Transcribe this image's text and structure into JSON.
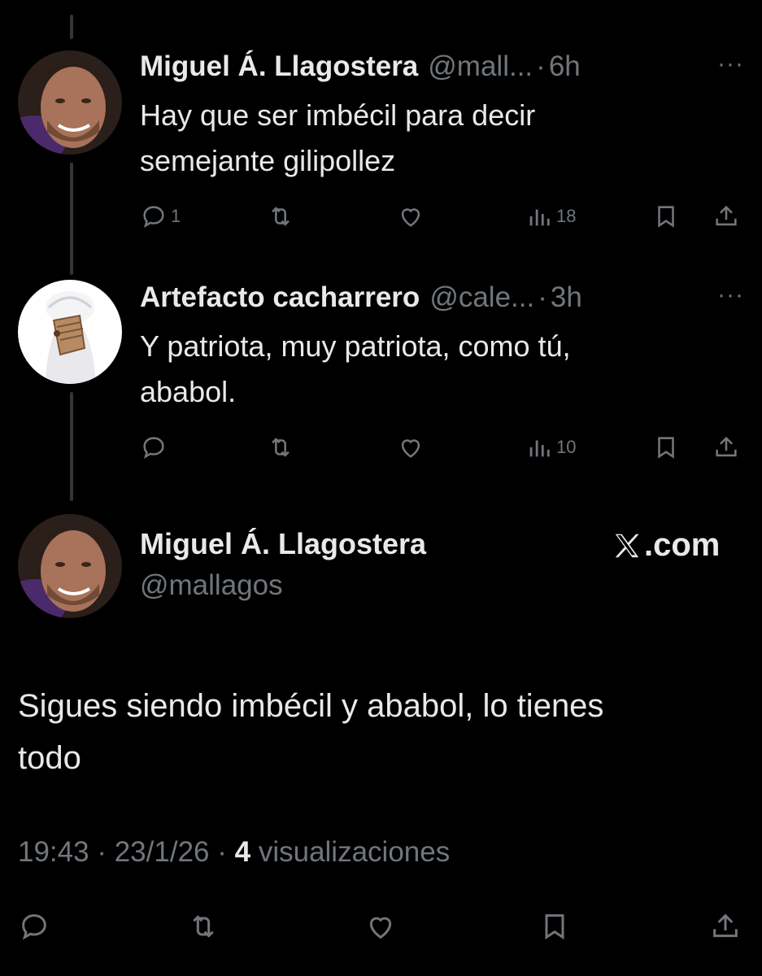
{
  "replies": [
    {
      "name": "Miguel Á. Llagostera",
      "handle": "@mall...",
      "time": "6h",
      "text_line1": "Hay que ser imbécil para decir",
      "text_line2": "semejante gilipollez",
      "reply_count": "1",
      "views": "18"
    },
    {
      "name": "Artefacto cacharrero",
      "handle": "@cale...",
      "time": "3h",
      "text_line1": "Y patriota, muy patriota, como tú,",
      "text_line2": "ababol.",
      "reply_count": "",
      "views": "10"
    }
  ],
  "separator": "·",
  "more_label": "···",
  "main": {
    "name": "Miguel Á. Llagostera",
    "handle": "@mallagos",
    "brand": ".com",
    "text_line1": "Sigues siendo imbécil y ababol, lo tienes",
    "text_line2": "todo",
    "time": "19:43",
    "date": "23/1/26",
    "views_count": "4",
    "views_label": "visualizaciones"
  },
  "icons": [
    "reply-icon",
    "retweet-icon",
    "like-icon",
    "views-icon",
    "bookmark-icon",
    "share-icon",
    "x-logo-icon"
  ],
  "colors": {
    "background": "#000000",
    "text": "#e7e9ea",
    "muted": "#71767b",
    "thread_line": "#333639"
  }
}
